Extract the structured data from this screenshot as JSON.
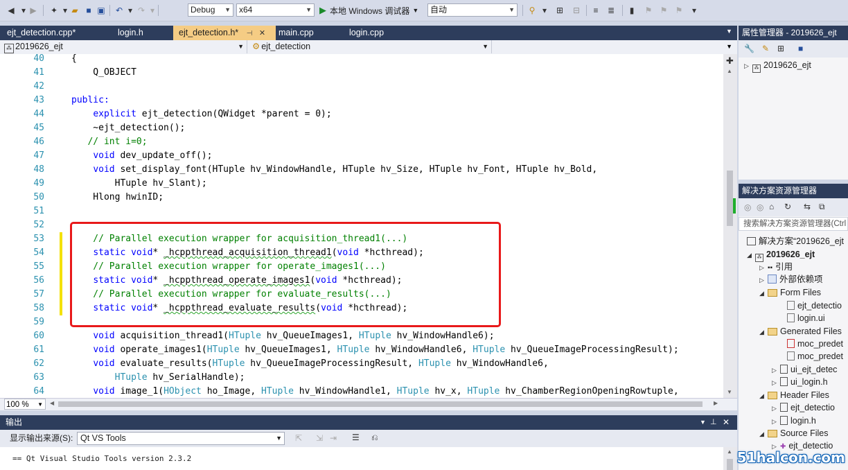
{
  "toolbar": {
    "config": "Debug",
    "platform": "x64",
    "run_label": "本地 Windows 调试器",
    "run_mode": "自动"
  },
  "tabs": [
    {
      "label": "ejt_detection.cpp*"
    },
    {
      "label": "login.h"
    },
    {
      "label": "ejt_detection.h*"
    },
    {
      "label": "main.cpp"
    },
    {
      "label": "login.cpp"
    }
  ],
  "nav": {
    "project": "2019626_ejt",
    "class": "ejt_detection"
  },
  "editor": {
    "zoom": "100 %",
    "lines": [
      {
        "n": "40"
      },
      {
        "n": "41"
      },
      {
        "n": "42"
      },
      {
        "n": "43"
      },
      {
        "n": "44"
      },
      {
        "n": "45"
      },
      {
        "n": "46"
      },
      {
        "n": "47"
      },
      {
        "n": "48"
      },
      {
        "n": "49"
      },
      {
        "n": "50"
      },
      {
        "n": "51"
      },
      {
        "n": "52"
      },
      {
        "n": "53"
      },
      {
        "n": "54"
      },
      {
        "n": "55"
      },
      {
        "n": "56"
      },
      {
        "n": "57"
      },
      {
        "n": "58"
      },
      {
        "n": "59"
      },
      {
        "n": "60"
      },
      {
        "n": "61"
      },
      {
        "n": "62"
      },
      {
        "n": "63"
      },
      {
        "n": "64"
      }
    ],
    "code": {
      "l40": "{",
      "l41": "    Q_OBJECT",
      "l43": "public:",
      "l44a": "explicit",
      "l44b": " ejt_detection(QWidget *parent = 0);",
      "l45": "    ~ejt_detection();",
      "l46": "   // int i=0;",
      "l47a": "void",
      "l47b": " dev_update_off();",
      "l48a": "void",
      "l48b": " set_display_font(HTuple hv_WindowHandle, HTuple hv_Size, HTuple hv_Font, HTuple hv_Bold,",
      "l49": "        HTuple hv_Slant);",
      "l50": "    Hlong hwinID;",
      "l53": "    // Parallel execution wrapper for acquisition_thread1(...)",
      "l54a": "static",
      "l54b": "void",
      "l54c": "* ",
      "l54d": "_hcppthread_acquisition_thread1",
      "l54e": "(",
      "l54f": "void",
      "l54g": " *hcthread);",
      "l55": "    // Parallel execution wrapper for operate_images1(...)",
      "l56a": "static",
      "l56b": "void",
      "l56c": "* ",
      "l56d": "_hcppthread_operate_images1",
      "l56e": "(",
      "l56f": "void",
      "l56g": " *hcthread);",
      "l57": "    // Parallel execution wrapper for evaluate_results(...)",
      "l58a": "static",
      "l58b": "void",
      "l58c": "* ",
      "l58d": "_hcppthread_evaluate_results",
      "l58e": "(",
      "l58f": "void",
      "l58g": " *hcthread);",
      "l60a": "void",
      "l60b": " acquisition_thread1(",
      "l60c": "HTuple",
      "l60d": " hv_QueueImages1, ",
      "l60e": "HTuple",
      "l60f": " hv_WindowHandle6);",
      "l61a": "void",
      "l61b": " operate_images1(",
      "l61c": "HTuple",
      "l61d": " hv_QueueImages1, ",
      "l61e": "HTuple",
      "l61f": " hv_WindowHandle6, ",
      "l61g": "HTuple",
      "l61h": " hv_QueueImageProcessingResult);",
      "l62a": "void",
      "l62b": " evaluate_results(",
      "l62c": "HTuple",
      "l62d": " hv_QueueImageProcessingResult, ",
      "l62e": "HTuple",
      "l62f": " hv_WindowHandle6,",
      "l63a": "HTuple",
      "l63b": " hv_SerialHandle);",
      "l64a": "void",
      "l64b": " image_1(",
      "l64c": "HObject",
      "l64d": " ho_Image, ",
      "l64e": "HTuple",
      "l64f": " hv_WindowHandle1, ",
      "l64g": "HTuple",
      "l64h": " hv_x, ",
      "l64i": "HTuple",
      "l64j": " hv_ChamberRegionOpeningRowtuple,"
    }
  },
  "output": {
    "title": "输出",
    "source_label": "显示输出来源(S):",
    "source_value": "Qt VS Tools",
    "text": "== Qt Visual Studio Tools version 2.3.2"
  },
  "property_manager": {
    "title": "属性管理器 - 2019626_ejt",
    "root": "2019626_ejt"
  },
  "solution_explorer": {
    "title": "解决方案资源管理器",
    "search_placeholder": "搜索解决方案资源管理器(Ctrl",
    "items": [
      {
        "label": "解决方案“2019626_ejt"
      },
      {
        "label": "2019626_ejt"
      },
      {
        "label": "引用"
      },
      {
        "label": "外部依赖项"
      },
      {
        "label": "Form Files"
      },
      {
        "label": "ejt_detectio"
      },
      {
        "label": "login.ui"
      },
      {
        "label": "Generated Files"
      },
      {
        "label": "moc_predet"
      },
      {
        "label": "moc_predet"
      },
      {
        "label": "ui_ejt_detec"
      },
      {
        "label": "ui_login.h"
      },
      {
        "label": "Header Files"
      },
      {
        "label": "ejt_detectio"
      },
      {
        "label": "login.h"
      },
      {
        "label": "Source Files"
      },
      {
        "label": "ejt_detectio"
      }
    ]
  },
  "watermark": "51halcon.com"
}
